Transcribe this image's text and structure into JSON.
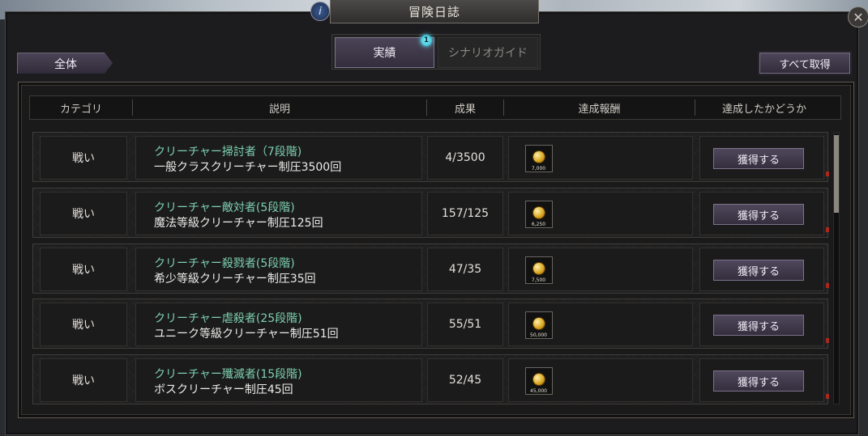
{
  "window": {
    "title": "冒険日誌"
  },
  "tabs": [
    {
      "label": "実績",
      "active": true,
      "badge": "1"
    },
    {
      "label": "シナリオガイド",
      "active": false
    }
  ],
  "filter": {
    "label": "全体"
  },
  "get_all_button": {
    "label": "すべて取得"
  },
  "table": {
    "headers": [
      "カテゴリ",
      "説明",
      "成果",
      "達成報酬",
      "達成したかどうか"
    ],
    "rows": [
      {
        "category": "戦い",
        "title": "クリーチャー掃討者（7段階)",
        "description": "一般クラスクリーチャー制圧3500回",
        "progress": "4/3500",
        "reward_amount": "7,000",
        "action": "獲得する"
      },
      {
        "category": "戦い",
        "title": "クリーチャー敵対者(5段階)",
        "description": "魔法等級クリーチャー制圧125回",
        "progress": "157/125",
        "reward_amount": "6,250",
        "action": "獲得する"
      },
      {
        "category": "戦い",
        "title": "クリーチャー殺戮者(5段階)",
        "description": "希少等級クリーチャー制圧35回",
        "progress": "47/35",
        "reward_amount": "7,500",
        "action": "獲得する"
      },
      {
        "category": "戦い",
        "title": "クリーチャー虐殺者(25段階)",
        "description": "ユニーク等級クリーチャー制圧51回",
        "progress": "55/51",
        "reward_amount": "50,000",
        "action": "獲得する"
      },
      {
        "category": "戦い",
        "title": "クリーチャー殲滅者(15段階)",
        "description": "ボスクリーチャー制圧45回",
        "progress": "52/45",
        "reward_amount": "45,000",
        "action": "獲得する"
      }
    ]
  },
  "colors": {
    "achievement_title": "#7ed0b0",
    "accent_button": "#4f475b",
    "badge": "#21a7c4"
  }
}
